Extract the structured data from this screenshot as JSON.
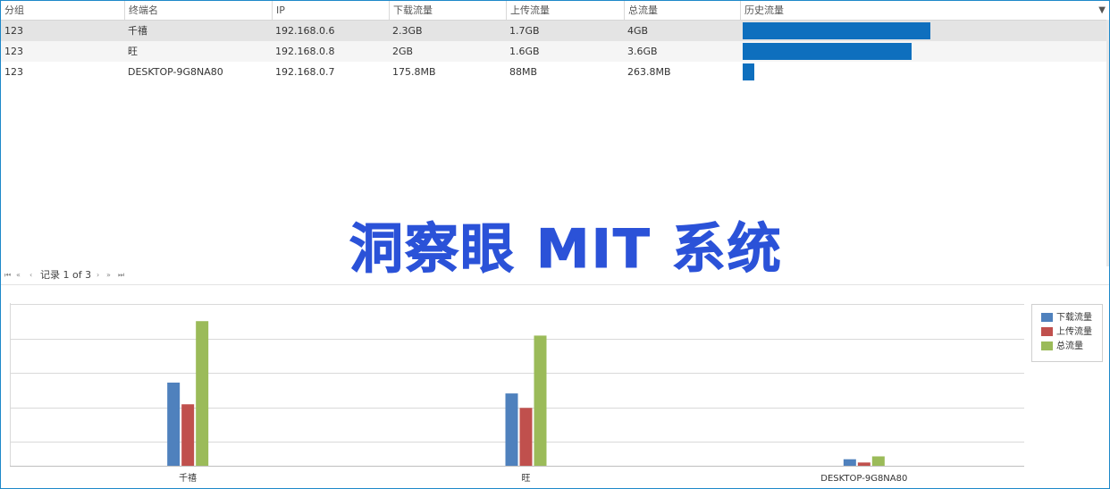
{
  "grid": {
    "headers": [
      "分组",
      "终端名",
      "IP",
      "下载流量",
      "上传流量",
      "总流量",
      "历史流量"
    ],
    "rows": [
      {
        "group": "123",
        "name": "千禧",
        "ip": "192.168.0.6",
        "download": "2.3GB",
        "upload": "1.7GB",
        "total": "4GB",
        "history": 1.0
      },
      {
        "group": "123",
        "name": "旺",
        "ip": "192.168.0.8",
        "download": "2GB",
        "upload": "1.6GB",
        "total": "3.6GB",
        "history": 0.9
      },
      {
        "group": "123",
        "name": "DESKTOP-9G8NA80",
        "ip": "192.168.0.7",
        "download": "175.8MB",
        "upload": "88MB",
        "total": "263.8MB",
        "history": 0.06
      }
    ],
    "chevron": "▼"
  },
  "pager": {
    "first": "⏮",
    "prev_page": "«",
    "prev": "‹",
    "label": "记录 1 of 3",
    "next": "›",
    "next_page": "»",
    "last": "⏭"
  },
  "watermark": "洞察眼 MIT 系统",
  "colors": {
    "download": "#4f81bd",
    "upload": "#c0504d",
    "total": "#9bbb59",
    "history_bar": "#0e6fbe",
    "watermark": "#2b52d8"
  },
  "chart_data": {
    "type": "bar",
    "categories": [
      "千禧",
      "旺",
      "DESKTOP-9G8NA80"
    ],
    "series": [
      {
        "name": "下载流量",
        "values": [
          2.3,
          2.0,
          0.18
        ]
      },
      {
        "name": "上传流量",
        "values": [
          1.7,
          1.6,
          0.09
        ]
      },
      {
        "name": "总流量",
        "values": [
          4.0,
          3.6,
          0.26
        ]
      }
    ],
    "ylim": [
      0,
      4.5
    ],
    "grid": true,
    "legend": "top-right",
    "xlabel": "",
    "ylabel": "",
    "title": ""
  }
}
